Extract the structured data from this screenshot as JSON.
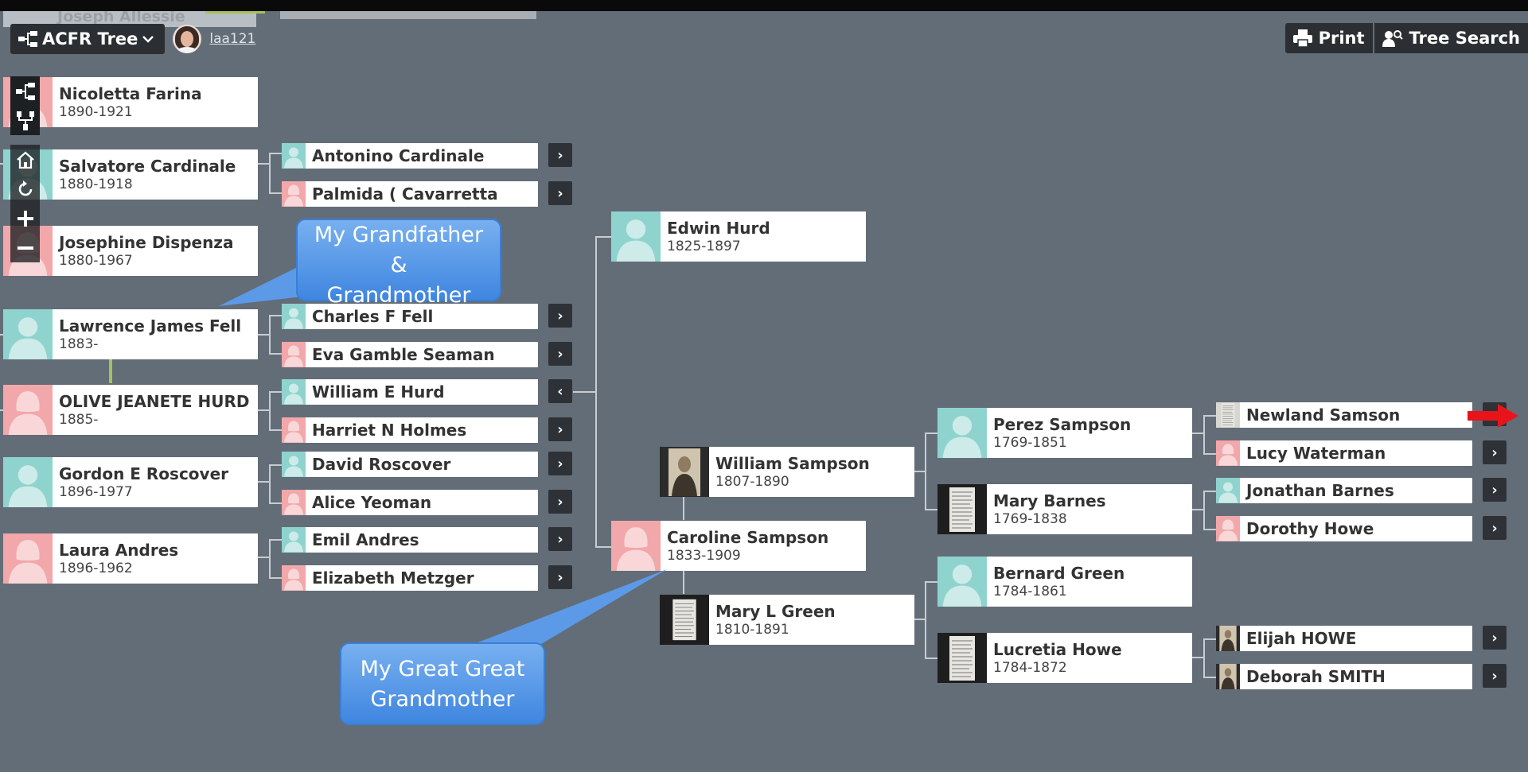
{
  "toolbar": {
    "tree_label": "ACFR Tree",
    "user_link": "laa121",
    "print_label": "Print",
    "search_label": "Tree Search"
  },
  "background_peek": {
    "name": "Joseph Allessie"
  },
  "column1": [
    {
      "name": "Nicoletta Farina",
      "dates": "1890-1921",
      "gender": "female"
    },
    {
      "name": "Salvatore Cardinale",
      "dates": "1880-1918",
      "gender": "male"
    },
    {
      "name": "Josephine Dispenza",
      "dates": "1880-1967",
      "gender": "female"
    },
    {
      "name": "Lawrence James Fell",
      "dates": "1883-",
      "gender": "male"
    },
    {
      "name": "OLIVE JEANETE HURD",
      "dates": "1885-",
      "gender": "female"
    },
    {
      "name": "Gordon E Roscover",
      "dates": "1896-1977",
      "gender": "male"
    },
    {
      "name": "Laura Andres",
      "dates": "1896-1962",
      "gender": "female"
    }
  ],
  "column2": [
    {
      "name": "Antonino Cardinale",
      "gender": "male"
    },
    {
      "name": "Palmida ( Cavarretta",
      "gender": "female"
    },
    {
      "name": "Charles F Fell",
      "gender": "male"
    },
    {
      "name": "Eva Gamble Seaman",
      "gender": "female"
    },
    {
      "name": "William E Hurd",
      "gender": "male"
    },
    {
      "name": "Harriet N Holmes",
      "gender": "female"
    },
    {
      "name": "David Roscover",
      "gender": "male"
    },
    {
      "name": "Alice Yeoman",
      "gender": "female"
    },
    {
      "name": "Emil Andres",
      "gender": "male"
    },
    {
      "name": "Elizabeth Metzger",
      "gender": "female"
    }
  ],
  "column3": [
    {
      "name": "Edwin Hurd",
      "dates": "1825-1897",
      "gender": "male"
    },
    {
      "name": "Caroline Sampson",
      "dates": "1833-1909",
      "gender": "female"
    }
  ],
  "column4": [
    {
      "name": "William Sampson",
      "dates": "1807-1890",
      "photo": "portrait"
    },
    {
      "name": "Mary L Green",
      "dates": "1810-1891",
      "photo": "document"
    }
  ],
  "column5": [
    {
      "name": "Perez Sampson",
      "dates": "1769-1851",
      "gender": "male"
    },
    {
      "name": "Mary Barnes",
      "dates": "1769-1838",
      "photo": "document"
    },
    {
      "name": "Bernard Green",
      "dates": "1784-1861",
      "gender": "male"
    },
    {
      "name": "Lucretia Howe",
      "dates": "1784-1872",
      "photo": "document"
    }
  ],
  "column6": [
    {
      "name": "Newland Samson",
      "photo": "document"
    },
    {
      "name": "Lucy Waterman",
      "gender": "female"
    },
    {
      "name": "Jonathan Barnes",
      "gender": "male"
    },
    {
      "name": "Dorothy Howe",
      "gender": "female"
    },
    {
      "name": "Elijah HOWE",
      "photo": "portrait"
    },
    {
      "name": "Deborah SMITH",
      "photo": "portrait"
    }
  ],
  "annotations": {
    "grandparents": [
      "My Grandfather",
      "&",
      "Grandmother"
    ],
    "great_great": [
      "My Great Great",
      "Grandmother"
    ]
  },
  "icons": {
    "tree": "tree-view-icon",
    "chevron": "chevron-down-icon",
    "print": "printer-icon",
    "search": "person-search-icon",
    "pedigree": "pedigree-view-icon",
    "descendant": "descendant-view-icon",
    "home": "home-icon",
    "reset": "reset-icon",
    "zoom_in": "zoom-in-icon",
    "zoom_out": "zoom-out-icon"
  },
  "colors": {
    "background": "#636d78",
    "male": "#8fd3cf",
    "female": "#f2a7aa",
    "callout": "#4a8fe6",
    "pointer": "#e8141b"
  }
}
